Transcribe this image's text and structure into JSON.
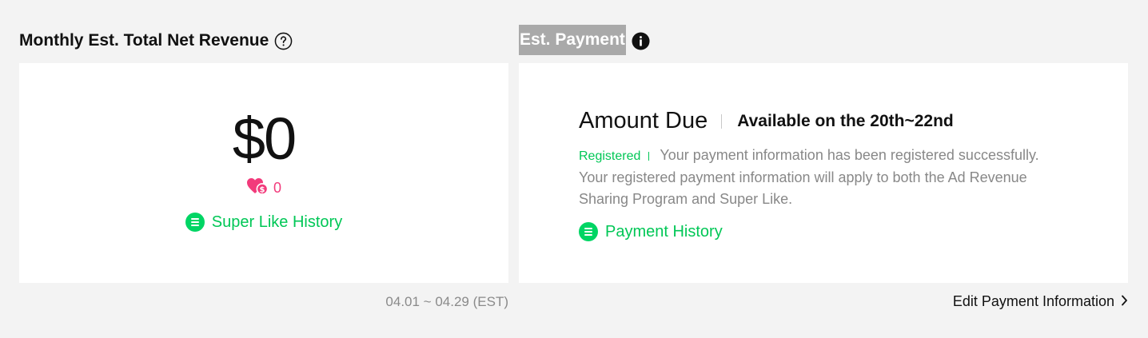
{
  "left": {
    "title": "Monthly Est. Total Net Revenue",
    "help_icon": "question-circle-icon",
    "amount": "$0",
    "super_like_icon": "heart-coin-icon",
    "super_like_count": "0",
    "history_label": "Super Like History",
    "history_icon": "list-icon",
    "date_range": "04.01 ~ 04.29 (EST)"
  },
  "right": {
    "title": "Est. Payment",
    "info_icon": "info-circle-icon",
    "amount_due_label": "Amount Due",
    "availability": "Available on the 20th~22nd",
    "status_badge": "Registered",
    "status_message": "Your payment information has been registered successfully. Your registered payment information will apply to both the Ad Revenue Sharing Program and Super Like.",
    "history_label": "Payment History",
    "history_icon": "list-icon",
    "edit_label": "Edit Payment Information",
    "edit_icon": "chevron-right-icon"
  },
  "colors": {
    "background": "#f3f3f3",
    "card": "#ffffff",
    "accent_green": "#00c756",
    "accent_pink": "#f23a7b",
    "muted_text": "#888888",
    "title_highlight": "#a9a9a9"
  }
}
